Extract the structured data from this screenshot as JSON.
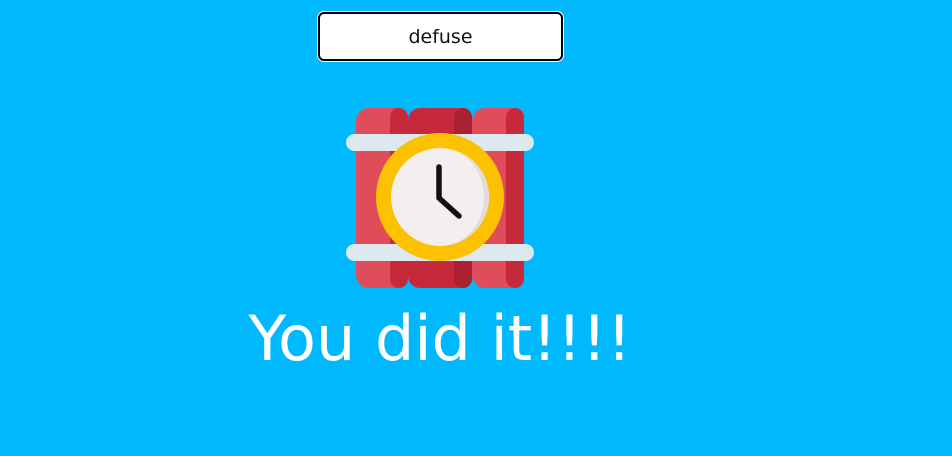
{
  "controls": {
    "defuse_label": "defuse"
  },
  "status": {
    "message": "You did it!!!!"
  },
  "icon": {
    "name": "time-bomb-icon"
  },
  "colors": {
    "background": "#00b9fd",
    "dynamite_red": "#df4d5a",
    "dynamite_dark_red": "#c62a3a",
    "clock_ring": "#fcc100",
    "clock_face": "#f4eeee",
    "strap": "#dde9ee",
    "message_text": "#ffffff"
  }
}
